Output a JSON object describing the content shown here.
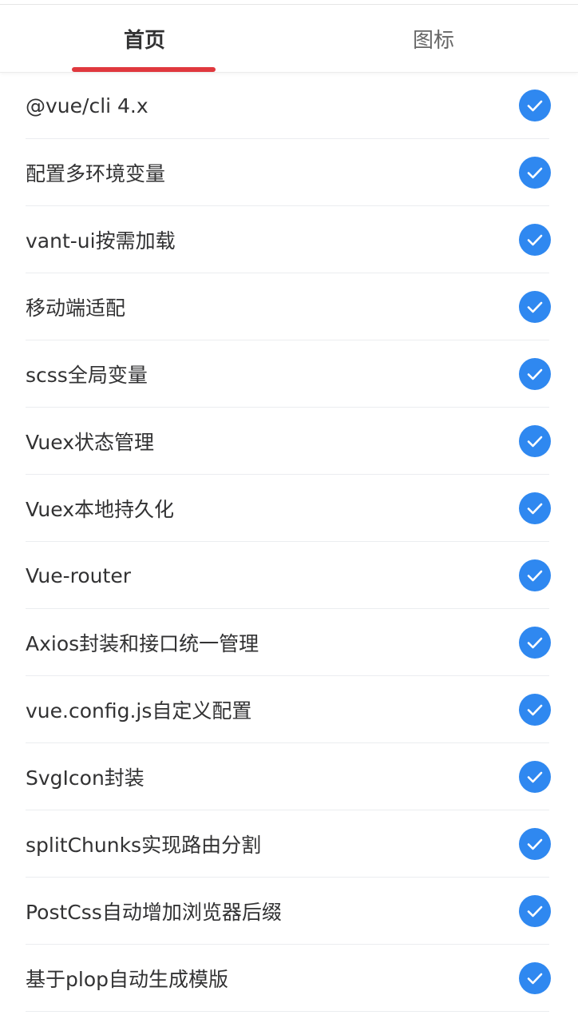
{
  "tabs": [
    {
      "label": "首页",
      "active": true
    },
    {
      "label": "图标",
      "active": false
    }
  ],
  "items": [
    {
      "label": "@vue/cli 4.x",
      "checked": true
    },
    {
      "label": "配置多环境变量",
      "checked": true
    },
    {
      "label": "vant-ui按需加载",
      "checked": true
    },
    {
      "label": "移动端适配",
      "checked": true
    },
    {
      "label": "scss全局变量",
      "checked": true
    },
    {
      "label": "Vuex状态管理",
      "checked": true
    },
    {
      "label": "Vuex本地持久化",
      "checked": true
    },
    {
      "label": "Vue-router",
      "checked": true
    },
    {
      "label": "Axios封装和接口统一管理",
      "checked": true
    },
    {
      "label": "vue.config.js自定义配置",
      "checked": true
    },
    {
      "label": "SvgIcon封装",
      "checked": true
    },
    {
      "label": "splitChunks实现路由分割",
      "checked": true
    },
    {
      "label": "PostCss自动增加浏览器后缀",
      "checked": true
    },
    {
      "label": "基于plop自动生成模版",
      "checked": true
    }
  ],
  "colors": {
    "accent": "#e0383e",
    "check": "#2f88f0",
    "text": "#323233"
  },
  "icons": {
    "check": "check-circle-icon"
  }
}
